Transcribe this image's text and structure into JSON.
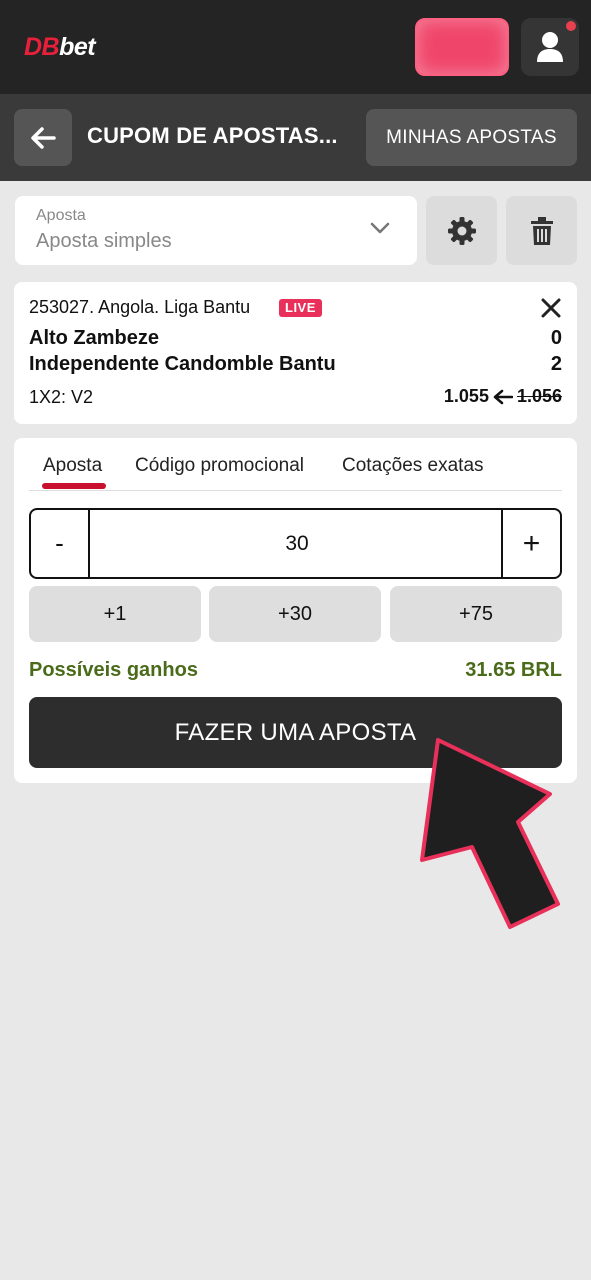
{
  "header": {
    "logo_db": "DB",
    "logo_bet": "bet",
    "accent_color": "#f0456a"
  },
  "subheader": {
    "title": "CUPOM DE APOSTAS...",
    "my_bets_label": "MINHAS APOSTAS"
  },
  "bet_type": {
    "label": "Aposta",
    "value": "Aposta simples"
  },
  "event": {
    "league": "253027. Angola. Liga Bantu",
    "live_badge": "LIVE",
    "team1": "Alto Zambeze",
    "team2": "Independente Candomble Bantu",
    "score1": "0",
    "score2": "2",
    "market": "1X2: V2",
    "new_odds": "1.055",
    "old_odds": "1.056"
  },
  "tabs": [
    {
      "label": "Aposta",
      "active": true
    },
    {
      "label": "Código promocional",
      "active": false
    },
    {
      "label": "Cotações exatas",
      "active": false
    }
  ],
  "stake": {
    "minus": "-",
    "value": "30",
    "plus": "+"
  },
  "quick_amounts": [
    "+1",
    "+30",
    "+75"
  ],
  "winnings": {
    "label": "Possíveis ganhos",
    "value": "31.65 BRL"
  },
  "place_bet_label": "FAZER UMA APOSTA"
}
